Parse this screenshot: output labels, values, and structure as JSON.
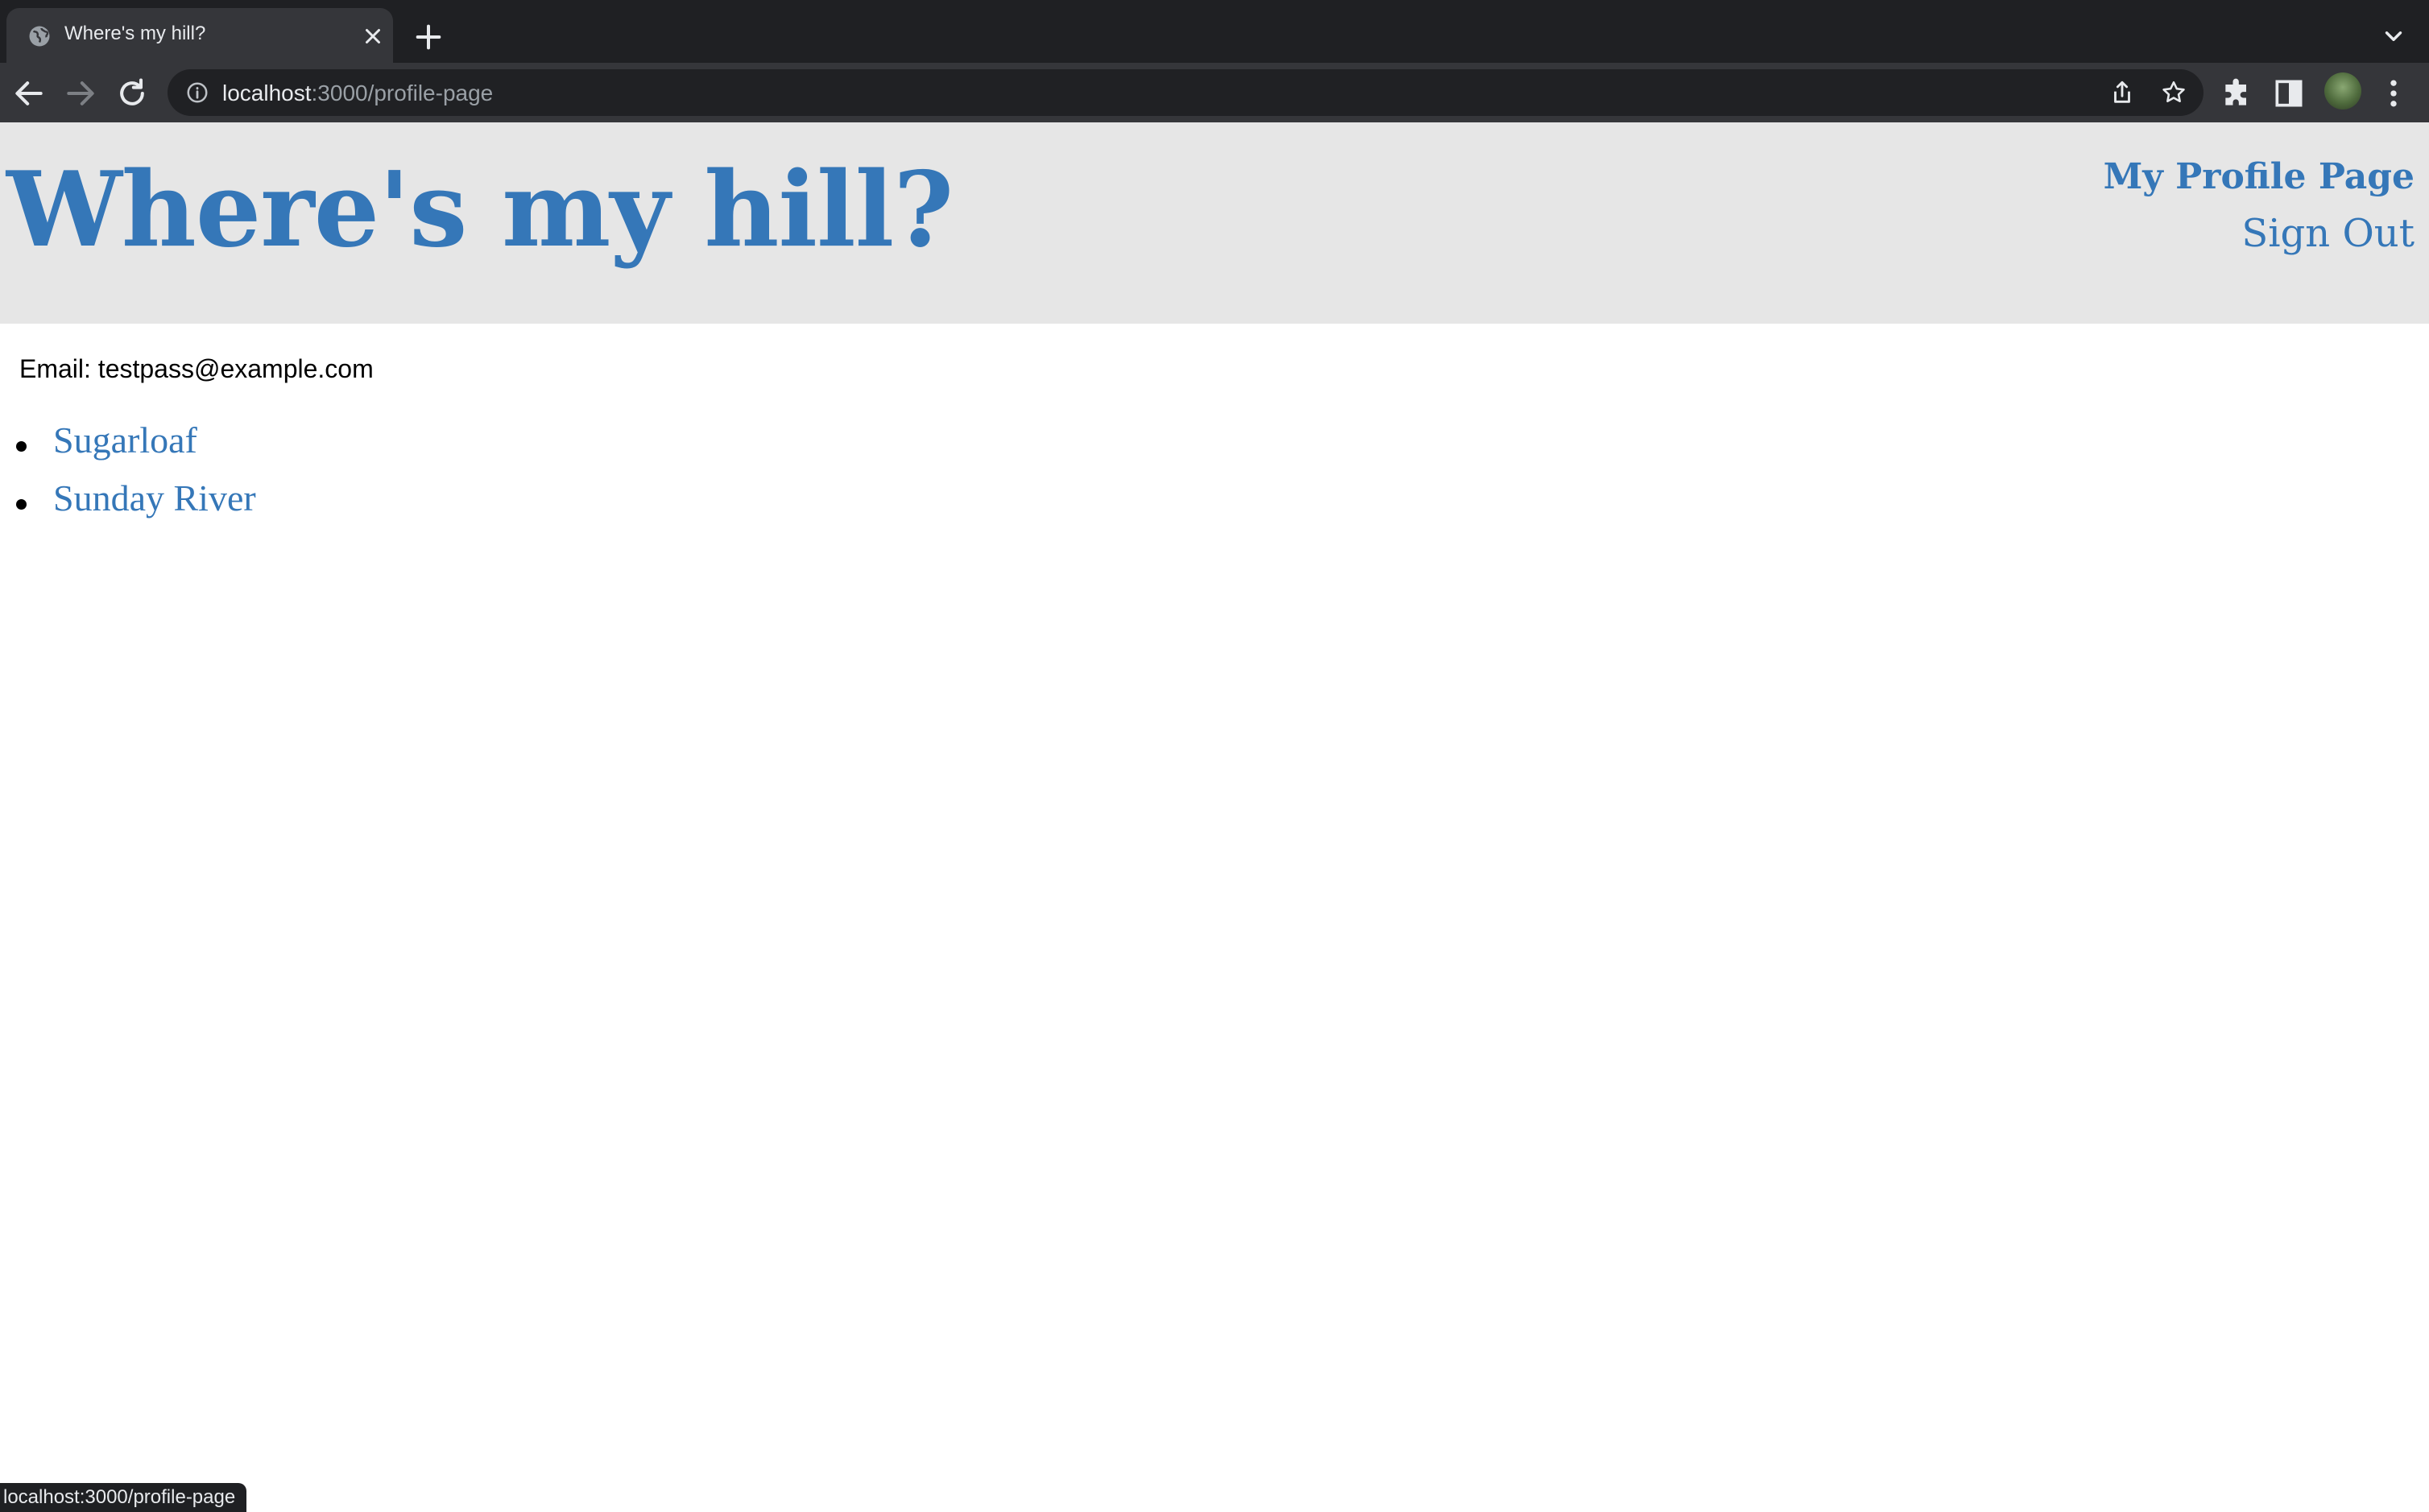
{
  "browser": {
    "tab": {
      "title": "Where's my hill?",
      "favicon": "globe-icon"
    },
    "address_bar": {
      "host": "localhost",
      "path": ":3000/profile-page"
    },
    "status_url": "localhost:3000/profile-page"
  },
  "site": {
    "title": "Where's my hill?",
    "nav": {
      "profile_label": "My Profile Page",
      "signout_label": "Sign Out"
    }
  },
  "profile": {
    "email_line": "Email: testpass@example.com",
    "hills": [
      {
        "name": "Sugarloaf"
      },
      {
        "name": "Sunday River"
      }
    ]
  },
  "colors": {
    "link_blue": "#3577b8",
    "header_bg": "#e6e6e6",
    "chrome_dark": "#1f2023",
    "chrome_toolbar": "#35363a"
  }
}
